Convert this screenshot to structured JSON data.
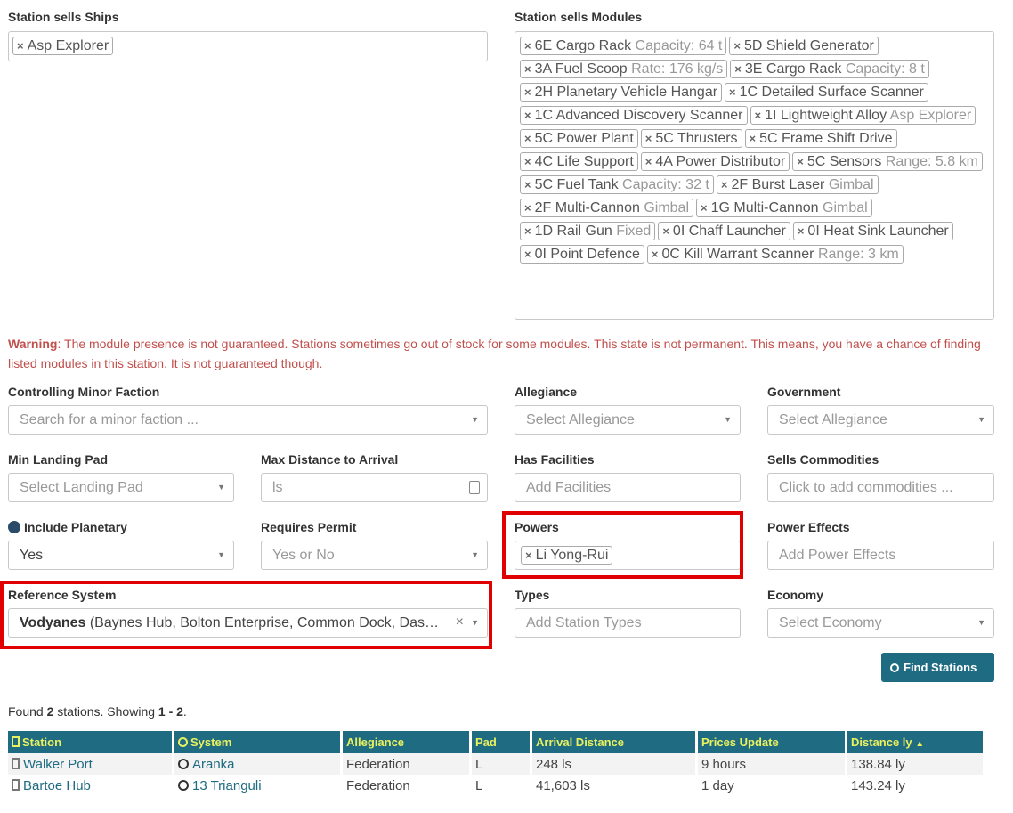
{
  "ships": {
    "label": "Station sells Ships",
    "tags": [
      "Asp Explorer"
    ]
  },
  "modules": {
    "label": "Station sells Modules",
    "tags": [
      {
        "name": "6E Cargo Rack",
        "sub": "Capacity: 64 t"
      },
      {
        "name": "5D Shield Generator",
        "sub": ""
      },
      {
        "name": "3A Fuel Scoop",
        "sub": "Rate: 176 kg/s"
      },
      {
        "name": "3E Cargo Rack",
        "sub": "Capacity: 8 t"
      },
      {
        "name": "2H Planetary Vehicle Hangar",
        "sub": ""
      },
      {
        "name": "1C Detailed Surface Scanner",
        "sub": ""
      },
      {
        "name": "1C Advanced Discovery Scanner",
        "sub": ""
      },
      {
        "name": "1I Lightweight Alloy",
        "sub": "Asp Explorer"
      },
      {
        "name": "5C Power Plant",
        "sub": ""
      },
      {
        "name": "5C Thrusters",
        "sub": ""
      },
      {
        "name": "5C Frame Shift Drive",
        "sub": ""
      },
      {
        "name": "4C Life Support",
        "sub": ""
      },
      {
        "name": "4A Power Distributor",
        "sub": ""
      },
      {
        "name": "5C Sensors",
        "sub": "Range: 5.8 km"
      },
      {
        "name": "5C Fuel Tank",
        "sub": "Capacity: 32 t"
      },
      {
        "name": "2F Burst Laser",
        "sub": "Gimbal"
      },
      {
        "name": "2F Multi-Cannon",
        "sub": "Gimbal"
      },
      {
        "name": "1G Multi-Cannon",
        "sub": "Gimbal"
      },
      {
        "name": "1D Rail Gun",
        "sub": "Fixed"
      },
      {
        "name": "0I Chaff Launcher",
        "sub": ""
      },
      {
        "name": "0I Heat Sink Launcher",
        "sub": ""
      },
      {
        "name": "0I Point Defence",
        "sub": ""
      },
      {
        "name": "0C Kill Warrant Scanner",
        "sub": "Range: 3 km"
      }
    ]
  },
  "warning": {
    "title": "Warning",
    "text": ": The module presence is not guaranteed. Stations sometimes go out of stock for some modules. This state is not permanent. This means, you have a chance of finding listed modules in this station. It is not guaranteed though."
  },
  "filters": {
    "minor_faction": {
      "label": "Controlling Minor Faction",
      "placeholder": "Search for a minor faction ..."
    },
    "allegiance": {
      "label": "Allegiance",
      "placeholder": "Select Allegiance"
    },
    "government": {
      "label": "Government",
      "placeholder": "Select Allegiance"
    },
    "landing_pad": {
      "label": "Min Landing Pad",
      "placeholder": "Select Landing Pad"
    },
    "max_distance": {
      "label": "Max Distance to Arrival",
      "placeholder": "ls"
    },
    "facilities": {
      "label": "Has Facilities",
      "placeholder": "Add Facilities"
    },
    "commodities": {
      "label": "Sells Commodities",
      "placeholder": "Click to add commodities ..."
    },
    "planetary": {
      "label": "Include Planetary",
      "value": "Yes"
    },
    "permit": {
      "label": "Requires Permit",
      "placeholder": "Yes or No"
    },
    "powers": {
      "label": "Powers",
      "tag": "Li Yong-Rui"
    },
    "power_effects": {
      "label": "Power Effects",
      "placeholder": "Add Power Effects"
    },
    "reference_system": {
      "label": "Reference System",
      "name": "Vodyanes",
      "detail": " (Baynes Hub, Bolton Enterprise, Common Dock, Das…"
    },
    "types": {
      "label": "Types",
      "placeholder": "Add Station Types"
    },
    "economy": {
      "label": "Economy",
      "placeholder": "Select Economy"
    }
  },
  "find_button": "Find Stations",
  "results": {
    "found_prefix": "Found ",
    "count": "2",
    "found_mid": " stations. Showing ",
    "range": "1 - 2",
    "found_suffix": ".",
    "columns": [
      "Station",
      "System",
      "Allegiance",
      "Pad",
      "Arrival Distance",
      "Prices Update",
      "Distance ly"
    ],
    "sort_indicator": "▲",
    "rows": [
      {
        "station": "Walker Port",
        "system": "Aranka",
        "allegiance": "Federation",
        "pad": "L",
        "arrival": "248 ls",
        "prices": "9 hours",
        "distance": "138.84 ly"
      },
      {
        "station": "Bartoe Hub",
        "system": "13 Trianguli",
        "allegiance": "Federation",
        "pad": "L",
        "arrival": "41,603 ls",
        "prices": "1 day",
        "distance": "143.24 ly"
      }
    ]
  },
  "colors": {
    "accent": "#1e6b82",
    "header_text": "#eaf15e",
    "warning": "#c0504d",
    "highlight": "#e00000"
  }
}
